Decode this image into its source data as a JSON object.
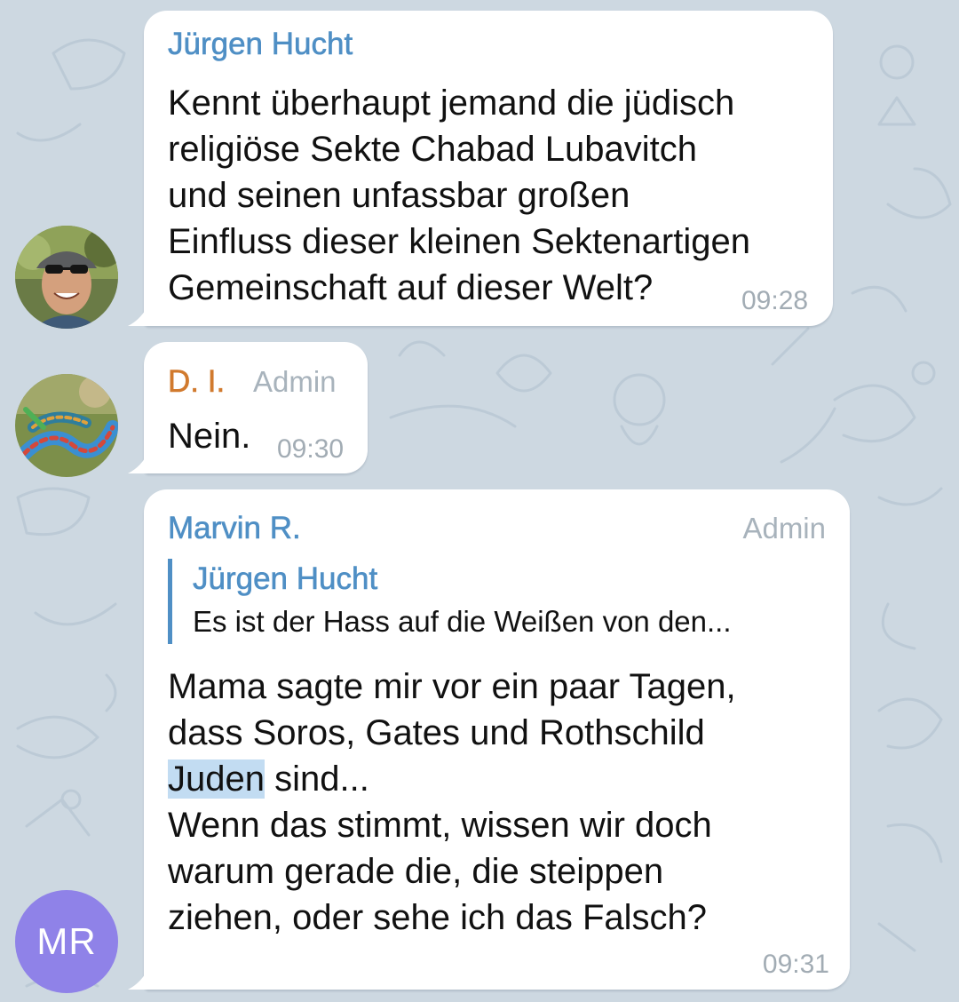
{
  "colors": {
    "background": "#cdd8e1",
    "bubble": "#ffffff",
    "sender_blue": "#4f8fc5",
    "sender_orange": "#d17a2e",
    "admin_gray": "#a8b3bc",
    "time_gray": "#a2acb4",
    "avatar_mr": "#8f82e8",
    "search_highlight": "#c2dcf2"
  },
  "messages": [
    {
      "sender": "Jürgen Hucht",
      "avatar_icon": "person-photo",
      "lines": [
        "Kennt überhaupt jemand die jüdisch",
        "religiöse Sekte Chabad Lubavitch",
        "und seinen unfassbar großen",
        "Einfluss dieser kleinen Sektenartigen",
        "Gemeinschaft auf dieser Welt?"
      ],
      "time": "09:28"
    },
    {
      "sender": "D. I.",
      "role": "Admin",
      "avatar_icon": "snake-photo",
      "lines": [
        "Nein."
      ],
      "time": "09:30"
    },
    {
      "sender": "Marvin R.",
      "role": "Admin",
      "avatar_initials": "MR",
      "reply": {
        "sender": "Jürgen Hucht",
        "text": "Es ist der Hass auf die  Weißen von den..."
      },
      "lines": [
        "Mama sagte mir vor ein paar Tagen,",
        "dass Soros, Gates und Rothschild"
      ],
      "highlighted_word": "Juden",
      "line3_rest": " sind...",
      "lines_after": [
        "Wenn das stimmt, wissen wir doch",
        "warum gerade die, die steippen",
        "ziehen, oder sehe ich das Falsch?"
      ],
      "time": "09:31"
    }
  ]
}
